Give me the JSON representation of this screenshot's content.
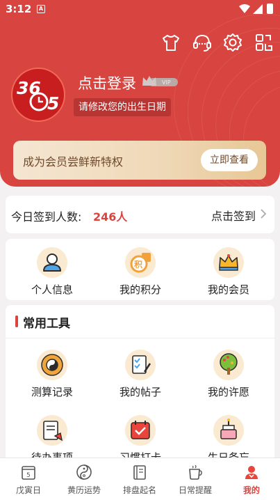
{
  "status_bar": {
    "time": "3:12",
    "notification_glyph": "A"
  },
  "colors": {
    "brand_red": "#d8443f",
    "gold": "#e7c795",
    "accent_brown": "#6d4a2d"
  },
  "header": {
    "icons": [
      "shirt-icon",
      "headset-icon",
      "settings-icon",
      "scan-icon"
    ],
    "logo": {
      "line1": "36",
      "line2": "5"
    },
    "login": "点击登录",
    "vip_badge": "VIP",
    "birth_hint": "请修改您的出生日期"
  },
  "vip_card": {
    "text": "成为会员尝鲜新特权",
    "button": "立即查看"
  },
  "checkin": {
    "label": "今日签到人数:",
    "count": "246人",
    "action": "点击签到"
  },
  "quick": {
    "items": [
      {
        "label": "个人信息",
        "icon": "user-icon"
      },
      {
        "label": "我的积分",
        "icon": "points-icon",
        "glyph": "积"
      },
      {
        "label": "我的会员",
        "icon": "crown-icon"
      }
    ]
  },
  "tools": {
    "title": "常用工具",
    "items": [
      {
        "label": "测算记录",
        "icon": "bagua-icon"
      },
      {
        "label": "我的帖子",
        "icon": "notes-icon"
      },
      {
        "label": "我的许愿",
        "icon": "wish-tree-icon"
      },
      {
        "label": "待办事项",
        "icon": "todo-icon"
      },
      {
        "label": "习惯打卡",
        "icon": "calendar-check-icon"
      },
      {
        "label": "生日备忘",
        "icon": "cake-icon"
      }
    ]
  },
  "tabbar": {
    "tabs": [
      {
        "label": "戊寅日",
        "icon": "calendar-day-icon",
        "day": "5"
      },
      {
        "label": "黄历运势",
        "icon": "yin-yang-icon"
      },
      {
        "label": "排盘起名",
        "icon": "book-icon"
      },
      {
        "label": "日常提醒",
        "icon": "cup-icon"
      },
      {
        "label": "我的",
        "icon": "profile-icon",
        "active": true
      }
    ]
  }
}
